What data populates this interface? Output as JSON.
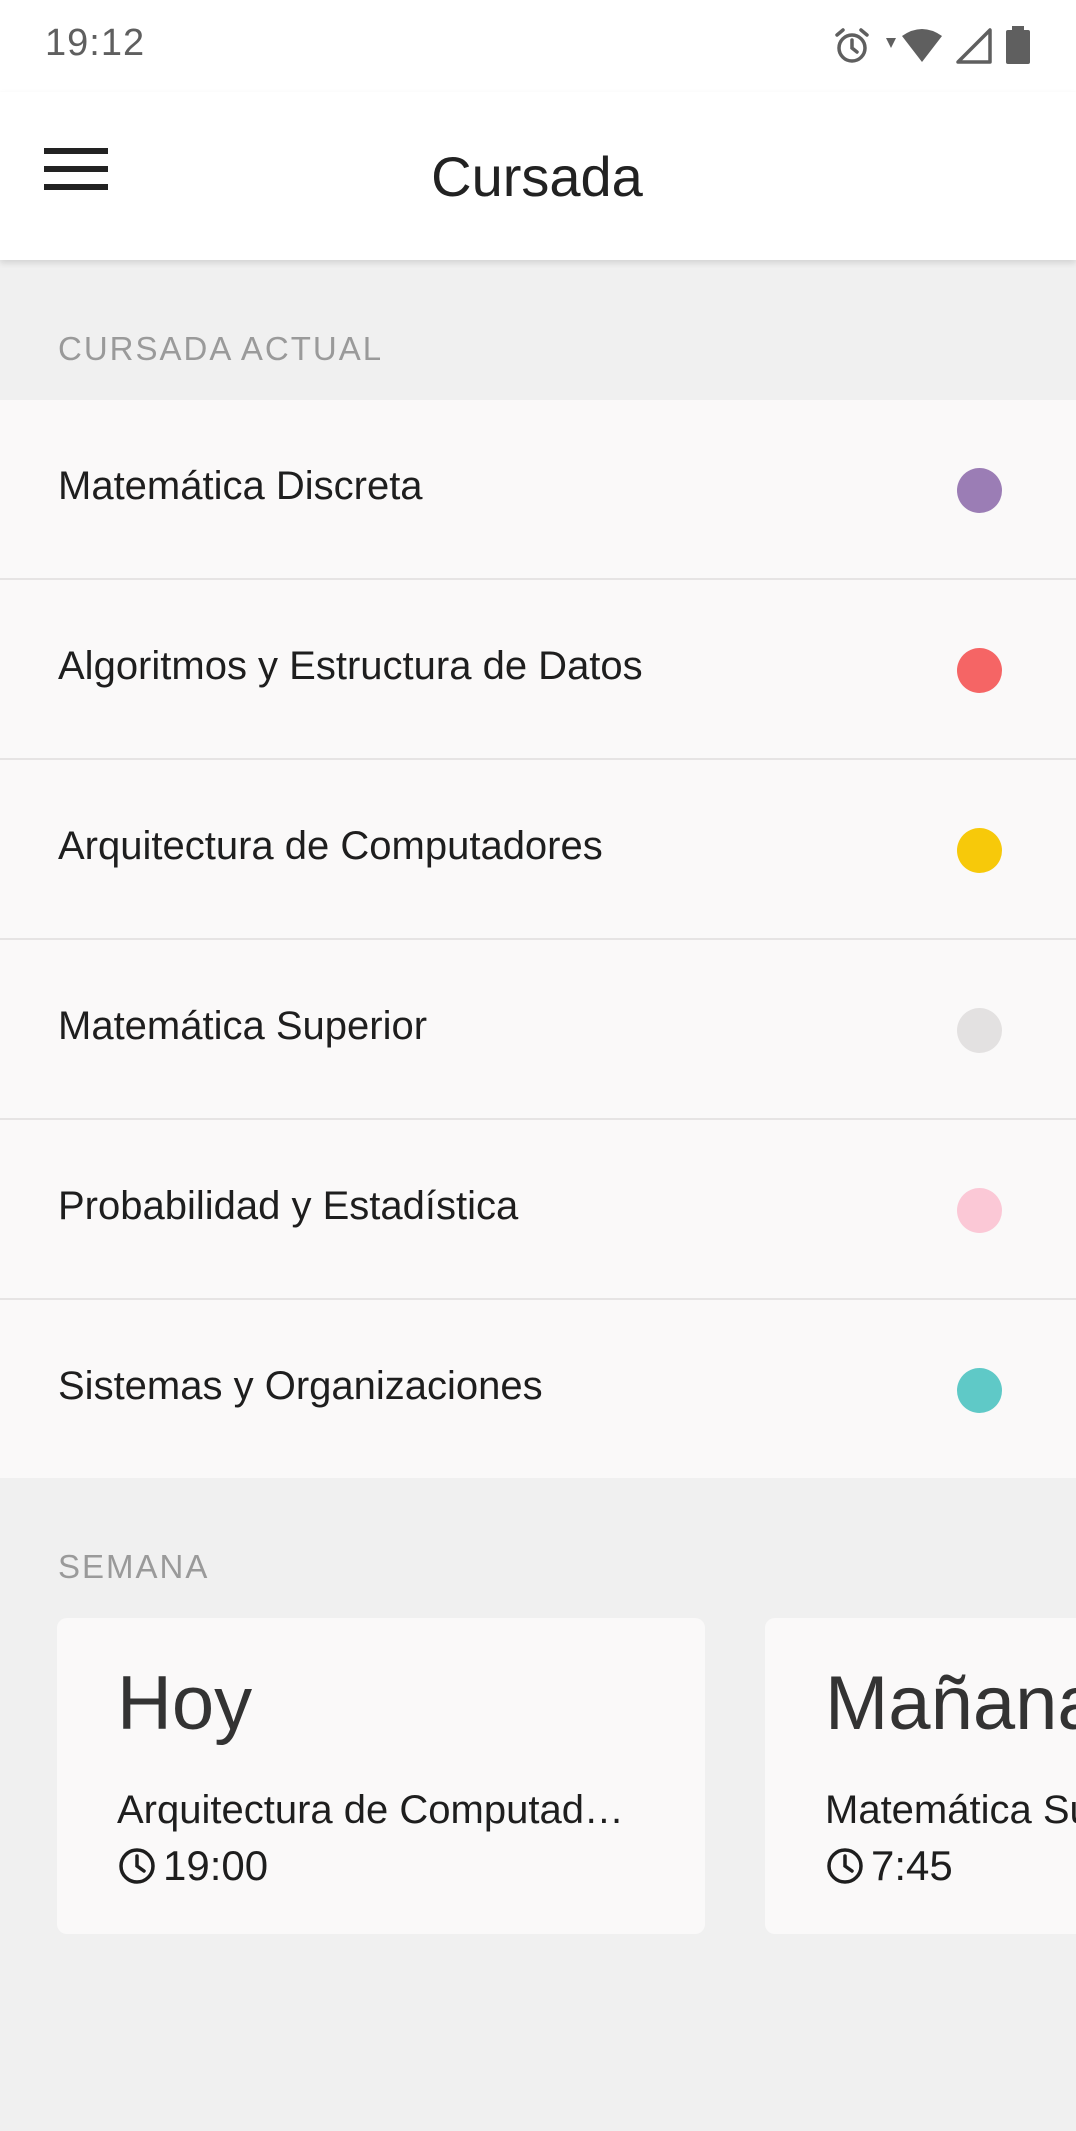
{
  "status_bar": {
    "time": "19:12",
    "icons": [
      "alarm-icon",
      "wifi-icon",
      "cell-signal-icon",
      "battery-icon"
    ]
  },
  "app_bar": {
    "menu_icon": "menu-icon",
    "title": "Cursada"
  },
  "current_courses": {
    "header": "CURSADA ACTUAL",
    "items": [
      {
        "label": "Matemática Discreta",
        "color": "#9b7db5"
      },
      {
        "label": "Algoritmos y Estructura de Datos",
        "color": "#f56565"
      },
      {
        "label": "Arquitectura de Computadores",
        "color": "#f7c90a"
      },
      {
        "label": "Matemática Superior",
        "color": "#e3e1e1"
      },
      {
        "label": "Probabilidad y Estadística",
        "color": "#fbc8d6"
      },
      {
        "label": "Sistemas y Organizaciones",
        "color": "#5fc9c7"
      }
    ]
  },
  "week": {
    "header": "SEMANA",
    "cards": [
      {
        "day": "Hoy",
        "subject": "Arquitectura de Computad…",
        "time": "19:00"
      },
      {
        "day": "Mañana",
        "subject": "Matemática Superior",
        "time": "7:45"
      }
    ]
  }
}
